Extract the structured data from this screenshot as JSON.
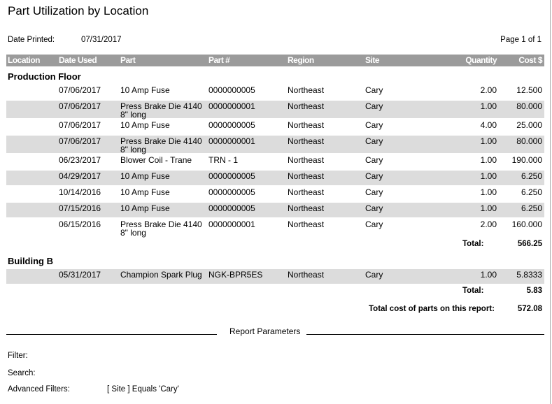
{
  "report": {
    "title": "Part Utilization by Location",
    "date_printed_label": "Date Printed:",
    "date_printed_value": "07/31/2017",
    "page_label": "Page 1 of 1"
  },
  "columns": [
    "Location",
    "Date Used",
    "Part",
    "Part #",
    "Region",
    "Site",
    "Quantity",
    "Cost $"
  ],
  "groups": [
    {
      "name": "Production Floor",
      "rows": [
        {
          "date": "07/06/2017",
          "part": "10 Amp Fuse",
          "part_no": "0000000005",
          "region": "Northeast",
          "site": "Cary",
          "qty": "2.00",
          "cost": "12.500"
        },
        {
          "date": "07/06/2017",
          "part": "Press Brake Die 4140 8\" long",
          "part_no": "0000000001",
          "region": "Northeast",
          "site": "Cary",
          "qty": "1.00",
          "cost": "80.000"
        },
        {
          "date": "07/06/2017",
          "part": "10 Amp Fuse",
          "part_no": "0000000005",
          "region": "Northeast",
          "site": "Cary",
          "qty": "4.00",
          "cost": "25.000"
        },
        {
          "date": "07/06/2017",
          "part": "Press Brake Die 4140 8\" long",
          "part_no": "0000000001",
          "region": "Northeast",
          "site": "Cary",
          "qty": "1.00",
          "cost": "80.000"
        },
        {
          "date": "06/23/2017",
          "part": "Blower Coil - Trane",
          "part_no": "TRN - 1",
          "region": "Northeast",
          "site": "Cary",
          "qty": "1.00",
          "cost": "190.000"
        },
        {
          "date": "04/29/2017",
          "part": "10 Amp Fuse",
          "part_no": "0000000005",
          "region": "Northeast",
          "site": "Cary",
          "qty": "1.00",
          "cost": "6.250"
        },
        {
          "date": "10/14/2016",
          "part": "10 Amp Fuse",
          "part_no": "0000000005",
          "region": "Northeast",
          "site": "Cary",
          "qty": "1.00",
          "cost": "6.250"
        },
        {
          "date": "07/15/2016",
          "part": "10 Amp Fuse",
          "part_no": "0000000005",
          "region": "Northeast",
          "site": "Cary",
          "qty": "1.00",
          "cost": "6.250"
        },
        {
          "date": "06/15/2016",
          "part": "Press Brake Die 4140 8\" long",
          "part_no": "0000000001",
          "region": "Northeast",
          "site": "Cary",
          "qty": "2.00",
          "cost": "160.000"
        }
      ],
      "total_label": "Total:",
      "total_value": "566.25"
    },
    {
      "name": "Building B",
      "rows": [
        {
          "date": "05/31/2017",
          "part": "Champion Spark Plug",
          "part_no": "NGK-BPR5ES",
          "region": "Northeast",
          "site": "Cary",
          "qty": "1.00",
          "cost": "5.8333"
        }
      ],
      "total_label": "Total:",
      "total_value": "5.83"
    }
  ],
  "grand_total": {
    "label": "Total cost of parts on this report:",
    "value": "572.08"
  },
  "parameters": {
    "heading": "Report Parameters",
    "filter_label": "Filter:",
    "filter_value": "",
    "search_label": "Search:",
    "search_value": "",
    "advanced_label": "Advanced Filters:",
    "advanced_value": "[ Site ] Equals 'Cary'"
  },
  "colors": {
    "header_bg": "#9b9b9b",
    "alt_row_bg": "#dcdcdc"
  }
}
